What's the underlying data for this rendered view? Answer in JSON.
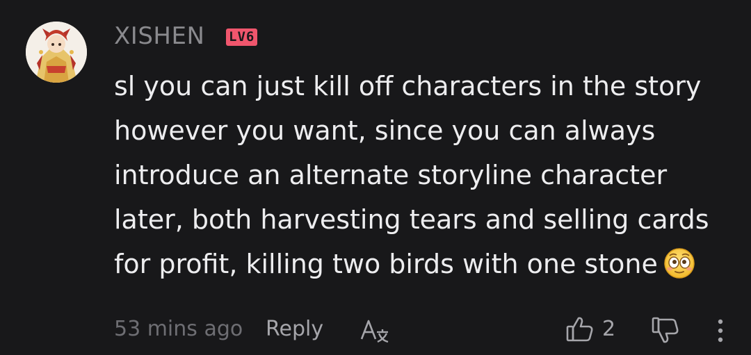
{
  "comment": {
    "username": "XISHEN",
    "level_badge": "LV6",
    "content_lines": [
      "sl you can just kill off characters in the story",
      "however you want, since you can always",
      "introduce an alternate storyline character",
      "later, both harvesting tears and selling cards",
      "for profit, killing two birds with one stone"
    ],
    "emoji": "flushed-face-emoji",
    "avatar_icon": "anime-character-avatar"
  },
  "footer": {
    "timestamp": "53 mins ago",
    "reply_label": "Reply",
    "translate_icon": "translate-icon",
    "like_icon": "thumbs-up-icon",
    "like_count": "2",
    "dislike_icon": "thumbs-down-icon",
    "more_icon": "more-vertical-icon"
  },
  "colors": {
    "background": "#18181a",
    "username": "#8a8a8e",
    "badge": "#f0566d",
    "text": "#ededef",
    "muted": "#6e6e73",
    "action": "#a6a6ab"
  }
}
